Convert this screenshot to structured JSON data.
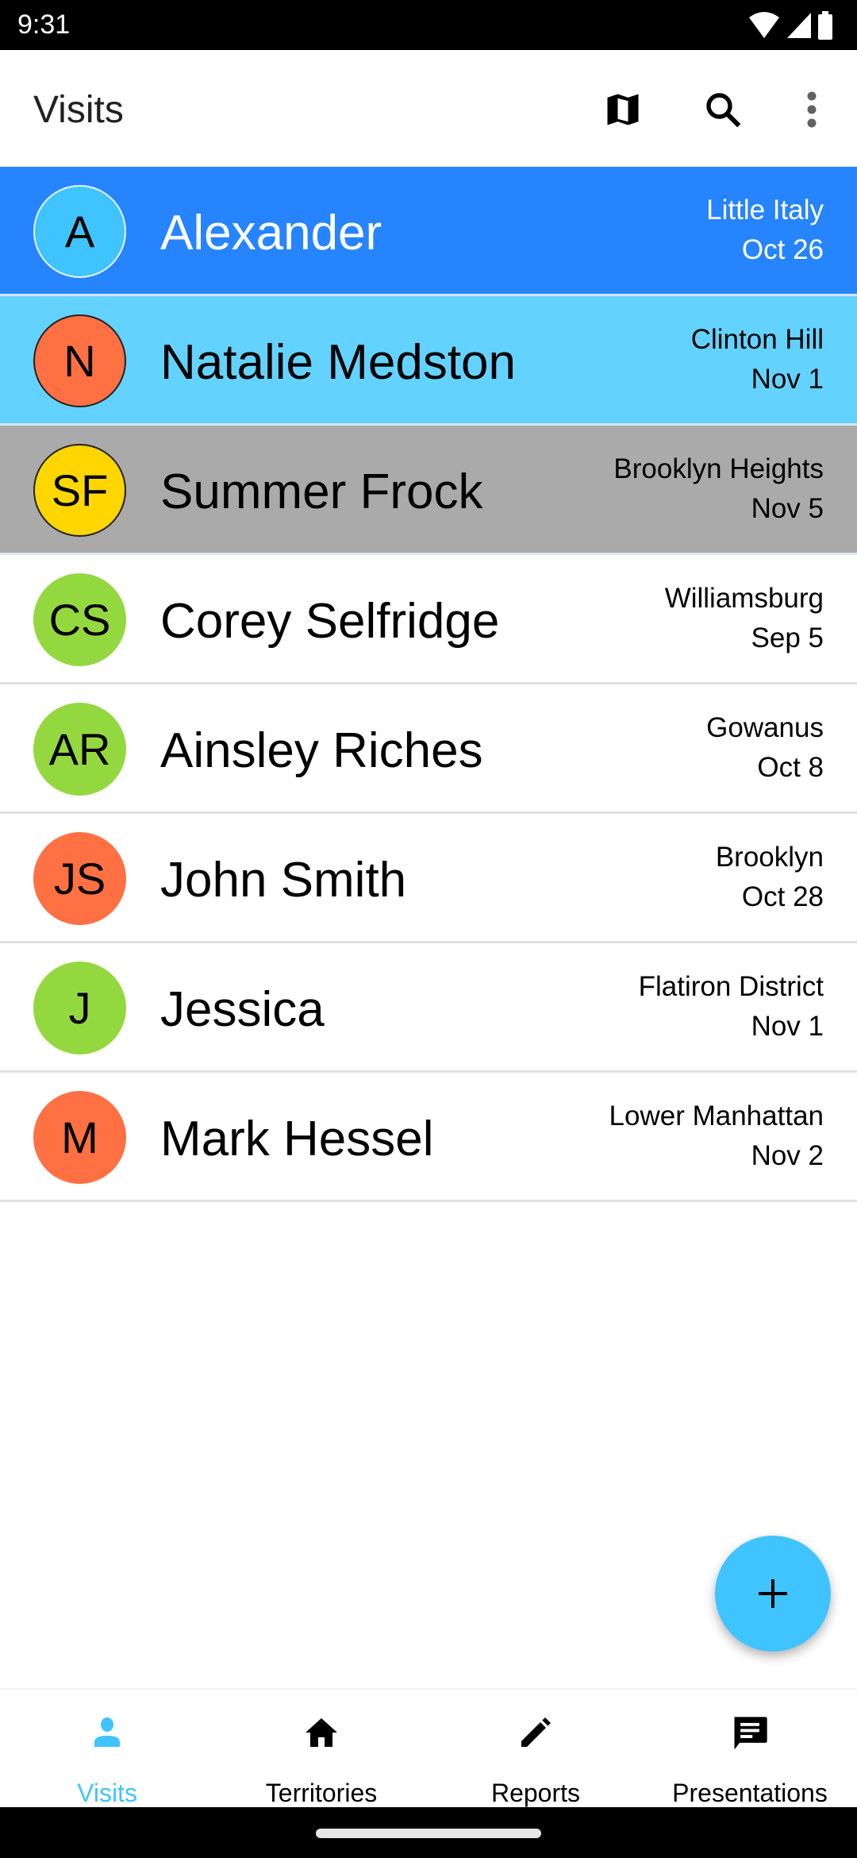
{
  "status_bar": {
    "time": "9:31",
    "icons": [
      "wifi-icon",
      "signal-icon",
      "battery-icon"
    ]
  },
  "app_bar": {
    "title": "Visits",
    "actions": [
      {
        "name": "map",
        "icon": "map-icon"
      },
      {
        "name": "search",
        "icon": "search-icon"
      },
      {
        "name": "more",
        "icon": "more-vert-icon"
      }
    ]
  },
  "visits": [
    {
      "initials": "A",
      "name": "Alexander",
      "location": "Little Italy",
      "date": "Oct 26",
      "avatar_color": "#40c4ff",
      "row_bg": "#2684ff",
      "text_color": "#ffffff"
    },
    {
      "initials": "N",
      "name": "Natalie Medston",
      "location": "Clinton Hill",
      "date": "Nov 1",
      "avatar_color": "#ff7043",
      "row_bg": "#64d2ff",
      "text_color": "#000000"
    },
    {
      "initials": "SF",
      "name": "Summer Frock",
      "location": "Brooklyn Heights",
      "date": "Nov 5",
      "avatar_color": "#ffd600",
      "row_bg": "#aaaaaa",
      "text_color": "#000000"
    },
    {
      "initials": "CS",
      "name": "Corey Selfridge",
      "location": "Williamsburg",
      "date": "Sep 5",
      "avatar_color": "#94d840",
      "row_bg": "#ffffff",
      "text_color": "#000000"
    },
    {
      "initials": "AR",
      "name": "Ainsley Riches",
      "location": "Gowanus",
      "date": "Oct 8",
      "avatar_color": "#94d840",
      "row_bg": "#ffffff",
      "text_color": "#000000"
    },
    {
      "initials": "JS",
      "name": "John Smith",
      "location": "Brooklyn",
      "date": "Oct 28",
      "avatar_color": "#ff7043",
      "row_bg": "#ffffff",
      "text_color": "#000000"
    },
    {
      "initials": "J",
      "name": "Jessica",
      "location": "Flatiron District",
      "date": "Nov 1",
      "avatar_color": "#94d840",
      "row_bg": "#ffffff",
      "text_color": "#000000"
    },
    {
      "initials": "M",
      "name": "Mark Hessel",
      "location": "Lower Manhattan",
      "date": "Nov 2",
      "avatar_color": "#ff7043",
      "row_bg": "#ffffff",
      "text_color": "#000000"
    }
  ],
  "fab": {
    "icon": "add-icon",
    "color": "#40c4ff"
  },
  "bottom_nav": {
    "active_color": "#40c4ff",
    "items": [
      {
        "label": "Visits",
        "icon": "person-icon",
        "active": true
      },
      {
        "label": "Territories",
        "icon": "home-icon",
        "active": false
      },
      {
        "label": "Reports",
        "icon": "pencil-icon",
        "active": false
      },
      {
        "label": "Presentations",
        "icon": "message-icon",
        "active": false
      }
    ]
  }
}
